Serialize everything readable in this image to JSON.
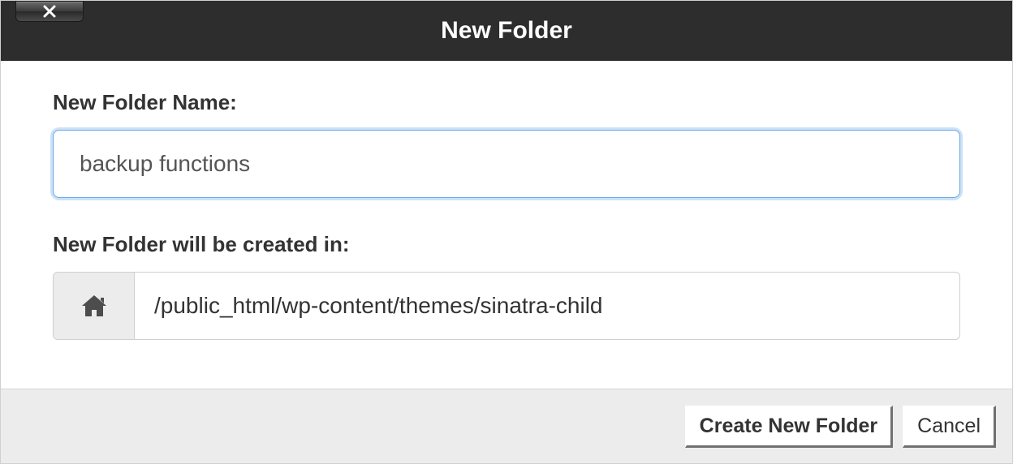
{
  "dialog": {
    "title": "New Folder",
    "name_label": "New Folder Name:",
    "name_value": "backup functions",
    "location_label": "New Folder will be created in:",
    "location_path": "/public_html/wp-content/themes/sinatra-child",
    "create_label": "Create New Folder",
    "cancel_label": "Cancel"
  }
}
